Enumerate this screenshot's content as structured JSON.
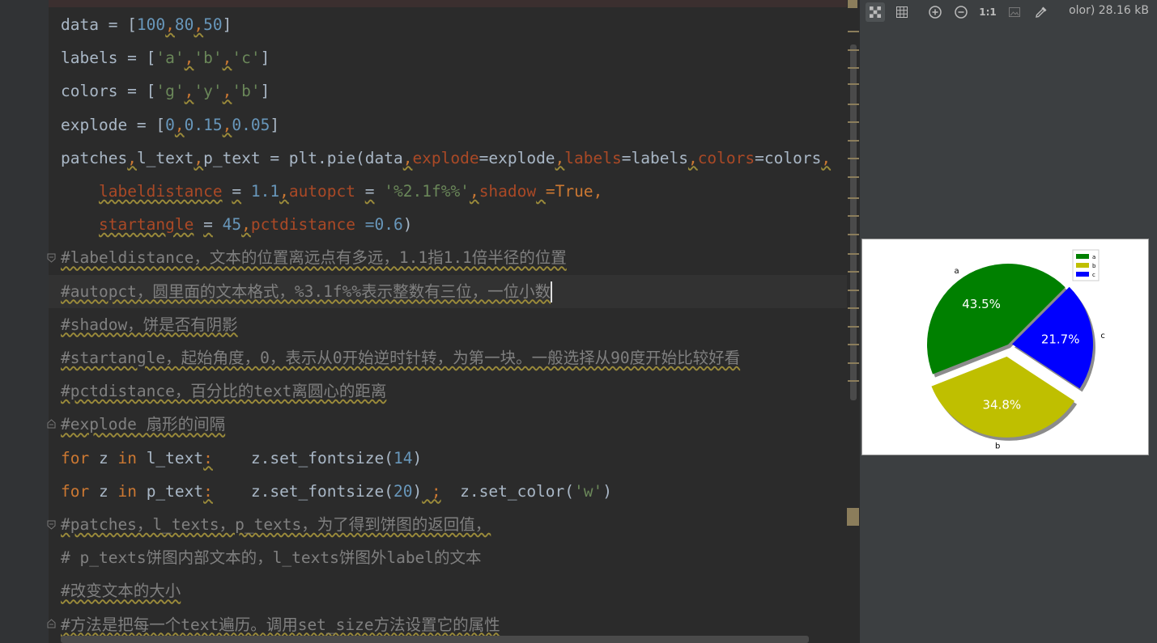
{
  "code_lines": [
    {
      "parts": [
        {
          "t": "data = ["
        },
        {
          "t": "100",
          "c": "num"
        },
        {
          "t": ",",
          "c": "comma wavy"
        },
        {
          "t": "80",
          "c": "num"
        },
        {
          "t": ",",
          "c": "comma wavy"
        },
        {
          "t": "50",
          "c": "num"
        },
        {
          "t": "]"
        }
      ]
    },
    {
      "parts": [
        {
          "t": "labels = ["
        },
        {
          "t": "'a'",
          "c": "str"
        },
        {
          "t": ",",
          "c": "comma wavy"
        },
        {
          "t": "'b'",
          "c": "str"
        },
        {
          "t": ",",
          "c": "comma wavy"
        },
        {
          "t": "'c'",
          "c": "str"
        },
        {
          "t": "]"
        }
      ]
    },
    {
      "parts": [
        {
          "t": "colors = ["
        },
        {
          "t": "'g'",
          "c": "str"
        },
        {
          "t": ",",
          "c": "comma wavy"
        },
        {
          "t": "'y'",
          "c": "str"
        },
        {
          "t": ",",
          "c": "comma wavy"
        },
        {
          "t": "'b'",
          "c": "str"
        },
        {
          "t": "]"
        }
      ]
    },
    {
      "parts": [
        {
          "t": "explode = ["
        },
        {
          "t": "0",
          "c": "num"
        },
        {
          "t": ",",
          "c": "comma wavy"
        },
        {
          "t": "0.15",
          "c": "num"
        },
        {
          "t": ",",
          "c": "comma wavy"
        },
        {
          "t": "0.05",
          "c": "num"
        },
        {
          "t": "]"
        }
      ]
    },
    {
      "parts": [
        {
          "t": "patches"
        },
        {
          "t": ",",
          "c": "comma wavy"
        },
        {
          "t": "l_text"
        },
        {
          "t": ",",
          "c": "comma wavy"
        },
        {
          "t": "p_text = plt.pie(data"
        },
        {
          "t": ",",
          "c": "comma wavy"
        },
        {
          "t": "explode",
          "c": "param"
        },
        {
          "t": "=explode"
        },
        {
          "t": ",",
          "c": "comma wavy"
        },
        {
          "t": "labels",
          "c": "param"
        },
        {
          "t": "=labels"
        },
        {
          "t": ",",
          "c": "comma wavy"
        },
        {
          "t": "colors",
          "c": "param"
        },
        {
          "t": "=colors"
        },
        {
          "t": ",",
          "c": "comma wavy"
        }
      ]
    },
    {
      "parts": [
        {
          "t": "    "
        },
        {
          "t": "labeldistance",
          "c": "param wavy"
        },
        {
          "t": " "
        },
        {
          "t": "=",
          "c": "wavy"
        },
        {
          "t": " "
        },
        {
          "t": "1.1",
          "c": "num"
        },
        {
          "t": ",",
          "c": "comma wavy"
        },
        {
          "t": "autopct",
          "c": "param"
        },
        {
          "t": " "
        },
        {
          "t": "=",
          "c": "wavy"
        },
        {
          "t": " "
        },
        {
          "t": "'%2.1f%%'",
          "c": "str"
        },
        {
          "t": ",",
          "c": "comma wavy"
        },
        {
          "t": "shadow",
          "c": "param"
        },
        {
          "t": " ",
          "c": "wavy"
        },
        {
          "t": "=True,",
          "c": "kw"
        }
      ]
    },
    {
      "parts": [
        {
          "t": "    "
        },
        {
          "t": "startangle",
          "c": "param wavy"
        },
        {
          "t": " "
        },
        {
          "t": "=",
          "c": "wavy"
        },
        {
          "t": " "
        },
        {
          "t": "45",
          "c": "num"
        },
        {
          "t": ",",
          "c": "comma wavy"
        },
        {
          "t": "pctdistance",
          "c": "param"
        },
        {
          "t": " "
        },
        {
          "t": "=0.6",
          "c": "num"
        },
        {
          "t": ")"
        }
      ]
    },
    {
      "parts": [
        {
          "t": "#labeldistance，文本的位置离远点有多远，1.1指1.1倍半径的位置",
          "c": "comment wavy"
        }
      ]
    },
    {
      "parts": [
        {
          "t": "#autopct，圆里面的文本格式，%3.1f%%表示整数有三位，一位小数",
          "c": "comment wavy"
        }
      ]
    },
    {
      "parts": [
        {
          "t": "#shadow，饼是否有阴影",
          "c": "comment wavy"
        }
      ]
    },
    {
      "parts": [
        {
          "t": "#startangle，起始角度，0，表示从0开始逆时针转，为第一块。一般选择从90度开始比较好看",
          "c": "comment wavy"
        }
      ]
    },
    {
      "parts": [
        {
          "t": "#pctdistance，百分比的text离圆心的距离",
          "c": "comment wavy"
        }
      ]
    },
    {
      "parts": [
        {
          "t": "#explode 扇形的间隔",
          "c": "comment wavy"
        }
      ]
    },
    {
      "parts": [
        {
          "t": "for",
          "c": "kw"
        },
        {
          "t": " z "
        },
        {
          "t": "in",
          "c": "kw"
        },
        {
          "t": " l_text"
        },
        {
          "t": ":",
          "c": "kw wavy"
        },
        {
          "t": "    z.set_fontsize("
        },
        {
          "t": "14",
          "c": "num"
        },
        {
          "t": ")"
        }
      ]
    },
    {
      "parts": [
        {
          "t": "for",
          "c": "kw"
        },
        {
          "t": " z "
        },
        {
          "t": "in",
          "c": "kw"
        },
        {
          "t": " p_text"
        },
        {
          "t": ":",
          "c": "kw wavy"
        },
        {
          "t": "    z.set_fontsize("
        },
        {
          "t": "20",
          "c": "num"
        },
        {
          "t": ")"
        },
        {
          "t": " ;",
          "c": "kw wavy"
        },
        {
          "t": "  z.set_color("
        },
        {
          "t": "'w'",
          "c": "str"
        },
        {
          "t": ")"
        }
      ]
    },
    {
      "parts": [
        {
          "t": "#patches，l_texts，p_texts，为了得到饼图的返回值，",
          "c": "comment wavy"
        }
      ]
    },
    {
      "parts": [
        {
          "t": "# p_texts饼图内部文本的，l_texts饼图外label的文本",
          "c": "comment"
        }
      ]
    },
    {
      "parts": [
        {
          "t": "#改变文本的大小",
          "c": "comment wavy"
        }
      ]
    },
    {
      "parts": [
        {
          "t": "#方法是把每一个text遍历。调用set_size方法设置它的属性",
          "c": "comment wavy"
        }
      ]
    }
  ],
  "toolbar": {
    "icons": [
      "chessboard-icon",
      "grid-icon",
      "zoom-in-icon",
      "zoom-out-icon",
      "actual-size-icon",
      "fit-image-icon",
      "color-picker-icon"
    ],
    "actual_size_label": "1:1",
    "info": "olor) 28.16 kB"
  },
  "chart_data": {
    "type": "pie",
    "categories": [
      "a",
      "b",
      "c"
    ],
    "values": [
      100,
      80,
      50
    ],
    "percent_labels": [
      "43.5%",
      "34.8%",
      "21.7%"
    ],
    "colors": [
      "#008000",
      "#bfbf00",
      "#0000ff"
    ],
    "explode": [
      0,
      0.15,
      0.05
    ],
    "startangle": 45,
    "shadow": true,
    "legend": {
      "placement": "top-right",
      "entries": [
        "a",
        "b",
        "c"
      ]
    }
  }
}
